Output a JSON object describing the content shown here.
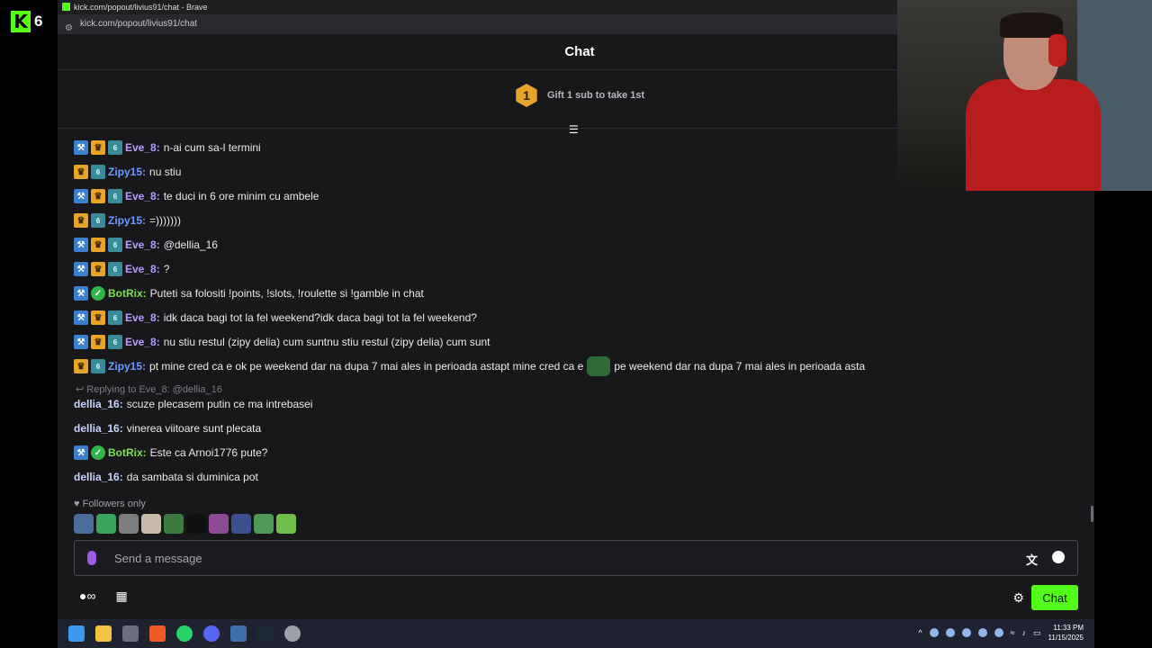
{
  "overlay": {
    "logo_letter": "K",
    "viewer_count": "6"
  },
  "browser": {
    "title": "kick.com/popout/livius91/chat - Brave",
    "url": "kick.com/popout/livius91/chat"
  },
  "chat": {
    "header": "Chat",
    "gift_rank": "1",
    "gift_text": "Gift 1 sub to take 1st",
    "messages": [
      {
        "user": "Eve_8",
        "text": "n-ai cum sa-l termini"
      },
      {
        "user": "Zipy15",
        "text": "nu stiu"
      },
      {
        "user": "Eve_8",
        "text": "te duci in 6 ore minim cu ambele"
      },
      {
        "user": "Zipy15",
        "text": "=)))))))"
      },
      {
        "user": "Eve_8",
        "text": "@dellia_16"
      },
      {
        "user": "Eve_8",
        "text": "?"
      },
      {
        "user": "BotRix",
        "text": "Puteti sa folositi !points, !slots, !roulette si !gamble in chat"
      },
      {
        "user": "Eve_8",
        "text": "idk daca bagi tot la fel weekend?idk daca bagi tot la fel weekend?"
      },
      {
        "user": "Eve_8",
        "text": "nu stiu restul (zipy delia) cum suntnu stiu restul (zipy delia) cum sunt"
      },
      {
        "user": "Zipy15",
        "text": "pt mine cred ca e ok pe weekend dar na dupa 7 mai ales in perioada astapt mine cred ca e",
        "text_after": "pe weekend dar na dupa 7 mai ales in perioada asta"
      },
      {
        "reply_to": "Replying to Eve_8: @dellia_16",
        "user": "dellia_16",
        "text": "scuze plecasem putin ce ma intrebasei"
      },
      {
        "user": "dellia_16",
        "text": "vinerea viitoare sunt plecata"
      },
      {
        "user": "BotRix",
        "text": "Este ca Arnoi1776 pute?"
      },
      {
        "user": "dellia_16",
        "text": "da sambata si duminica pot"
      }
    ],
    "followers_label": "Followers only",
    "input_placeholder": "Send a message",
    "chat_button": "Chat"
  },
  "colors": {
    "accent": "#53fc18",
    "background": "#18181b",
    "eve_name": "#b79dff",
    "zipy_name": "#6e9bff",
    "botrix_name": "#78e04a"
  },
  "taskbar": {
    "time": "11:33 PM",
    "date": "11/15/2025"
  }
}
